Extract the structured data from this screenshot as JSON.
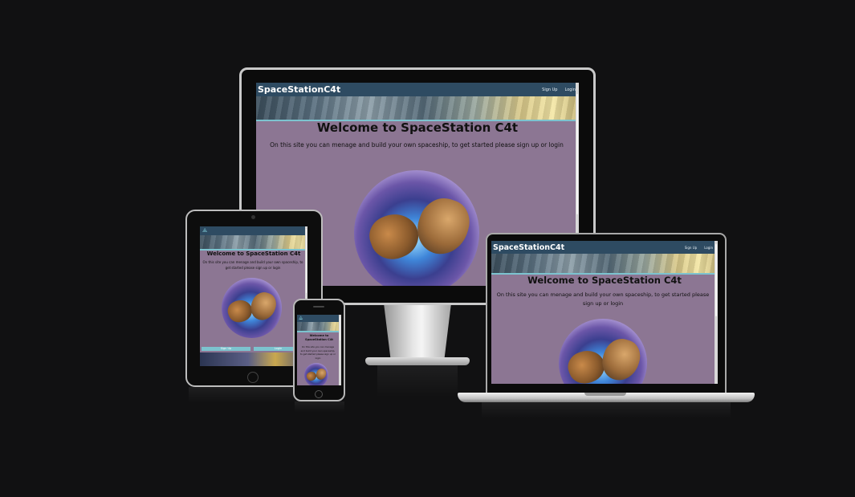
{
  "site": {
    "brand": "SpaceStationC4t",
    "nav_signup": "Sign Up",
    "nav_login": "Login",
    "heading": "Welcome to SpaceStation C4t",
    "intro": "On this site you can menage and build your own spaceship, to get started please sign up or login",
    "hero_image": "space-cats-image",
    "btn_signup": "Sign Up",
    "btn_login": "Login",
    "logo_icon": "ship-logo-icon",
    "logo_glyph": "⟁"
  },
  "colors": {
    "background": "#111112",
    "page_background": "#8c7693",
    "nav_background": "#2e4b62",
    "accent": "#7cc3cf"
  },
  "devices": [
    "desktop-monitor",
    "laptop",
    "tablet",
    "phone"
  ]
}
